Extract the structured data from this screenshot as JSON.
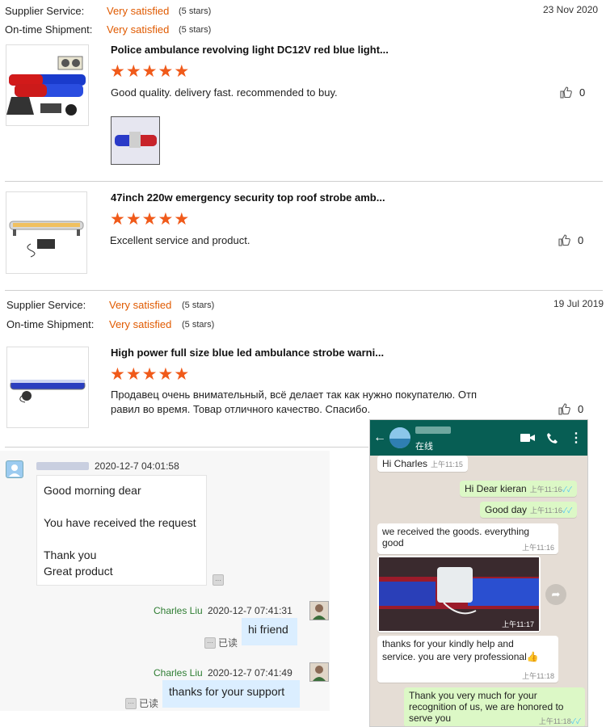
{
  "review1": {
    "supplier_label": "Supplier Service:",
    "supplier_value": "Very satisfied",
    "supplier_stars": "(5 stars)",
    "shipment_label": "On-time Shipment:",
    "shipment_value": "Very satisfied",
    "shipment_stars": "(5 stars)",
    "date": "23 Nov 2020",
    "products": [
      {
        "title": "Police ambulance revolving light DC12V red blue light...",
        "rating": 5,
        "text": "Good quality. delivery fast. recommended to buy.",
        "likes": "0"
      },
      {
        "title": "47inch 220w emergency security top roof strobe amb...",
        "rating": 5,
        "text": "Excellent service and product.",
        "likes": "0"
      }
    ]
  },
  "review2": {
    "supplier_label": "Supplier Service:",
    "supplier_value": "Very satisfied",
    "supplier_stars": "(5 stars)",
    "shipment_label": "On-time Shipment:",
    "shipment_value": "Very satisfied",
    "shipment_stars": "(5 stars)",
    "date": "19 Jul 2019",
    "product": {
      "title": "High power full size blue led ambulance strobe warni...",
      "rating": 5,
      "text_line1": "Продавец очень внимательный, всё делает так как нужно покупателю. Отп",
      "text_line2": "равил во время. Товар отличного качество. Спасибо.",
      "likes": "0"
    }
  },
  "chat": {
    "first_time": "2020-12-7 04:01:58",
    "first_lines": [
      "Good morning dear",
      "You have received the request",
      "Thank you",
      "Great product"
    ],
    "reply1_name": "Charles Liu",
    "reply1_time": "2020-12-7 07:41:31",
    "reply1_text": "hi friend",
    "reply2_name": "Charles Liu",
    "reply2_time": "2020-12-7 07:41:49",
    "reply2_text": "thanks for your support",
    "read_label": "已读"
  },
  "whatsapp": {
    "status": "在线",
    "header_color": "#075e54",
    "messages": [
      {
        "text": "Hi Charles",
        "time": "上午11:15"
      },
      {
        "text": "Hi Dear kieran",
        "time": "上午11:16"
      },
      {
        "text": "Good day",
        "time": "上午11:16"
      },
      {
        "text_line1": "we received the goods. everything",
        "text_line2": "good",
        "time": "上午11:16"
      },
      {
        "time": "上午11:17"
      },
      {
        "text_line1": "thanks for your kindly help and",
        "text_line2": "service. you are very professional",
        "time": "上午11:18"
      },
      {
        "text_line1": "Thank you very much for your",
        "text_line2": "recognition of us, we are honored to",
        "text_line3": "serve you",
        "time": "上午11:18"
      }
    ]
  },
  "colors": {
    "accent_orange": "#e05a00",
    "star": "#f05a1a",
    "wa_green": "#075e54"
  }
}
